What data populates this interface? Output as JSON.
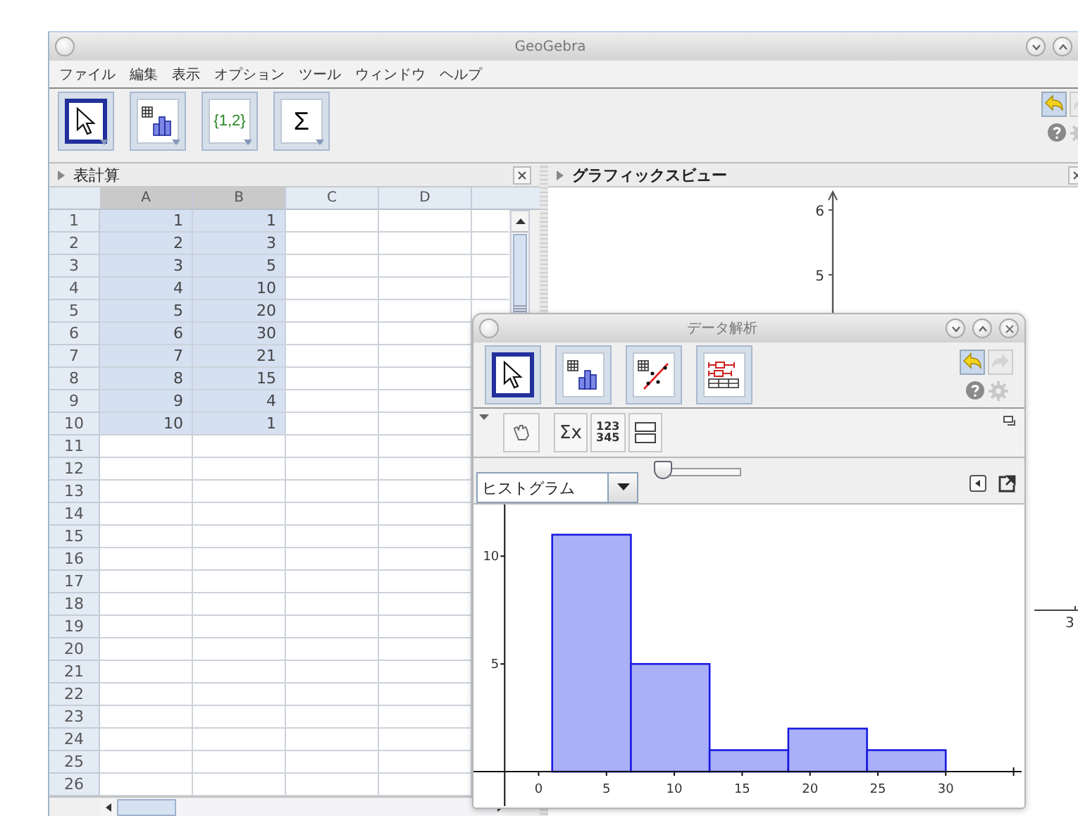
{
  "window": {
    "title": "GeoGebra"
  },
  "menu": [
    "ファイル",
    "編集",
    "表示",
    "オプション",
    "ツール",
    "ウィンドウ",
    "ヘルプ"
  ],
  "toolbar": {
    "tools": [
      {
        "kind": "pointer",
        "selected": true
      },
      {
        "kind": "chart",
        "selected": false
      },
      {
        "kind": "text",
        "label": "{1,2}",
        "selected": false
      },
      {
        "kind": "text",
        "label": "Σ",
        "selected": false
      }
    ]
  },
  "spreadsheet": {
    "title": "表計算",
    "columns": [
      {
        "label": "A",
        "selected": true
      },
      {
        "label": "B",
        "selected": true
      },
      {
        "label": "C",
        "selected": false
      },
      {
        "label": "D",
        "selected": false
      }
    ],
    "rows": [
      {
        "header": "1",
        "cells": [
          {
            "value": "1",
            "selected": true
          },
          {
            "value": "1",
            "selected": true
          }
        ]
      },
      {
        "header": "2",
        "cells": [
          {
            "value": "2",
            "selected": true
          },
          {
            "value": "3",
            "selected": true
          }
        ]
      },
      {
        "header": "3",
        "cells": [
          {
            "value": "3",
            "selected": true
          },
          {
            "value": "5",
            "selected": true
          }
        ]
      },
      {
        "header": "4",
        "cells": [
          {
            "value": "4",
            "selected": true
          },
          {
            "value": "10",
            "selected": true
          }
        ]
      },
      {
        "header": "5",
        "cells": [
          {
            "value": "5",
            "selected": true
          },
          {
            "value": "20",
            "selected": true
          }
        ]
      },
      {
        "header": "6",
        "cells": [
          {
            "value": "6",
            "selected": true
          },
          {
            "value": "30",
            "selected": true
          }
        ]
      },
      {
        "header": "7",
        "cells": [
          {
            "value": "7",
            "selected": true
          },
          {
            "value": "21",
            "selected": true
          }
        ]
      },
      {
        "header": "8",
        "cells": [
          {
            "value": "8",
            "selected": true
          },
          {
            "value": "15",
            "selected": true
          }
        ]
      },
      {
        "header": "9",
        "cells": [
          {
            "value": "9",
            "selected": true
          },
          {
            "value": "4",
            "selected": true
          }
        ]
      },
      {
        "header": "10",
        "cells": [
          {
            "value": "10",
            "selected": true
          },
          {
            "value": "1",
            "selected": true
          }
        ]
      },
      {
        "header": "11"
      },
      {
        "header": "12"
      },
      {
        "header": "13"
      },
      {
        "header": "14"
      },
      {
        "header": "15"
      },
      {
        "header": "16"
      },
      {
        "header": "17"
      },
      {
        "header": "18"
      },
      {
        "header": "19"
      },
      {
        "header": "20"
      },
      {
        "header": "21"
      },
      {
        "header": "22"
      },
      {
        "header": "23"
      },
      {
        "header": "24"
      },
      {
        "header": "25"
      },
      {
        "header": "26"
      }
    ]
  },
  "graphics_view": {
    "title": "グラフィックスビュー",
    "y_axis_labels": [
      "6",
      "5"
    ],
    "x_axis_labels": [
      "3"
    ]
  },
  "data_analysis": {
    "title": "データ解析",
    "tools": [
      {
        "kind": "pointer",
        "selected": true
      },
      {
        "kind": "chart",
        "selected": false
      },
      {
        "kind": "scatter",
        "selected": false
      },
      {
        "kind": "boxplot",
        "selected": false
      }
    ],
    "options": [
      {
        "kind": "hand"
      },
      {
        "kind": "text",
        "label": "Σx"
      },
      {
        "kind": "stack",
        "lines": [
          "123",
          "345"
        ]
      },
      {
        "kind": "layout"
      }
    ],
    "chart_type": {
      "value": "ヒストグラム"
    },
    "slider": {
      "level": 0.05
    },
    "chart_data": {
      "type": "bar",
      "x": [
        3.9,
        9.7,
        15.5,
        21.3,
        27.1
      ],
      "values": [
        11,
        5,
        1,
        2,
        1
      ],
      "xticks": [
        0,
        5,
        10,
        15,
        20,
        25,
        30
      ],
      "yticks": [
        5,
        10
      ],
      "xlim": [
        -4.8,
        35.8
      ],
      "ylim": [
        -1.6,
        12.4
      ]
    }
  }
}
